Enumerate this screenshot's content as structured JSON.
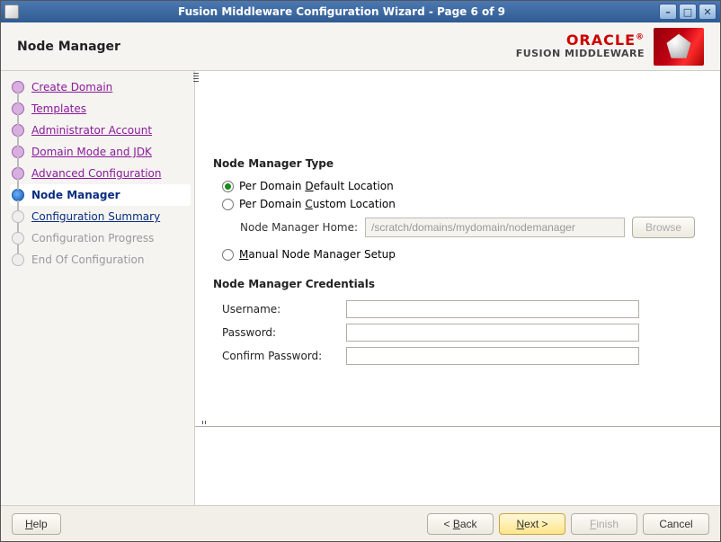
{
  "window": {
    "title": "Fusion Middleware Configuration Wizard - Page 6 of 9"
  },
  "header": {
    "page_title": "Node Manager",
    "brand_line1": "ORACLE",
    "brand_line2": "FUSION MIDDLEWARE"
  },
  "sidebar": {
    "steps": [
      {
        "label": "Create Domain",
        "state": "completed"
      },
      {
        "label": "Templates",
        "state": "completed"
      },
      {
        "label": "Administrator Account",
        "state": "completed"
      },
      {
        "label": "Domain Mode and JDK",
        "state": "completed"
      },
      {
        "label": "Advanced Configuration",
        "state": "completed"
      },
      {
        "label": "Node Manager",
        "state": "current"
      },
      {
        "label": "Configuration Summary",
        "state": "upcoming-link"
      },
      {
        "label": "Configuration Progress",
        "state": "upcoming-disabled"
      },
      {
        "label": "End Of Configuration",
        "state": "upcoming-disabled"
      }
    ]
  },
  "form": {
    "type_heading": "Node Manager Type",
    "radio1_pre": "Per Domain ",
    "radio1_accel": "D",
    "radio1_post": "efault Location",
    "radio2_pre": "Per Domain ",
    "radio2_accel": "C",
    "radio2_post": "ustom Location",
    "home_label": "Node Manager Home:",
    "home_value": "/scratch/domains/mydomain/nodemanager",
    "browse_label": "Browse",
    "radio3_accel": "M",
    "radio3_post": "anual Node Manager Setup",
    "cred_heading": "Node Manager Credentials",
    "username_label": "Username:",
    "username_value": "",
    "password_label": "Password:",
    "password_value": "",
    "confirm_label": "Confirm Password:",
    "confirm_value": ""
  },
  "footer": {
    "help_accel": "H",
    "help_post": "elp",
    "back_pre": "< ",
    "back_accel": "B",
    "back_post": "ack",
    "next_accel": "N",
    "next_post": "ext >",
    "finish_accel": "F",
    "finish_post": "inish",
    "cancel": "Cancel"
  }
}
